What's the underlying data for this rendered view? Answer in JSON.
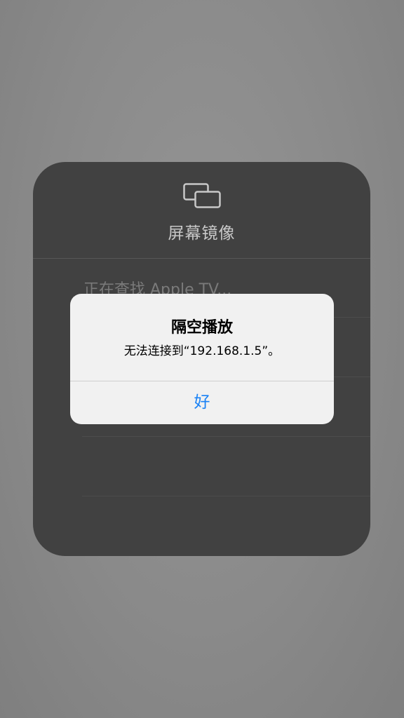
{
  "mirroring_panel": {
    "icon": "screen-mirroring-icon",
    "title": "屏幕镜像",
    "status_text": "正在查找 Apple TV..."
  },
  "alert": {
    "title": "隔空播放",
    "message": "无法连接到“192.168.1.5”。",
    "ok_label": "好"
  },
  "colors": {
    "accent": "#1a82f5",
    "panel_bg": "#414141",
    "alert_bg": "#f1f1f1"
  }
}
